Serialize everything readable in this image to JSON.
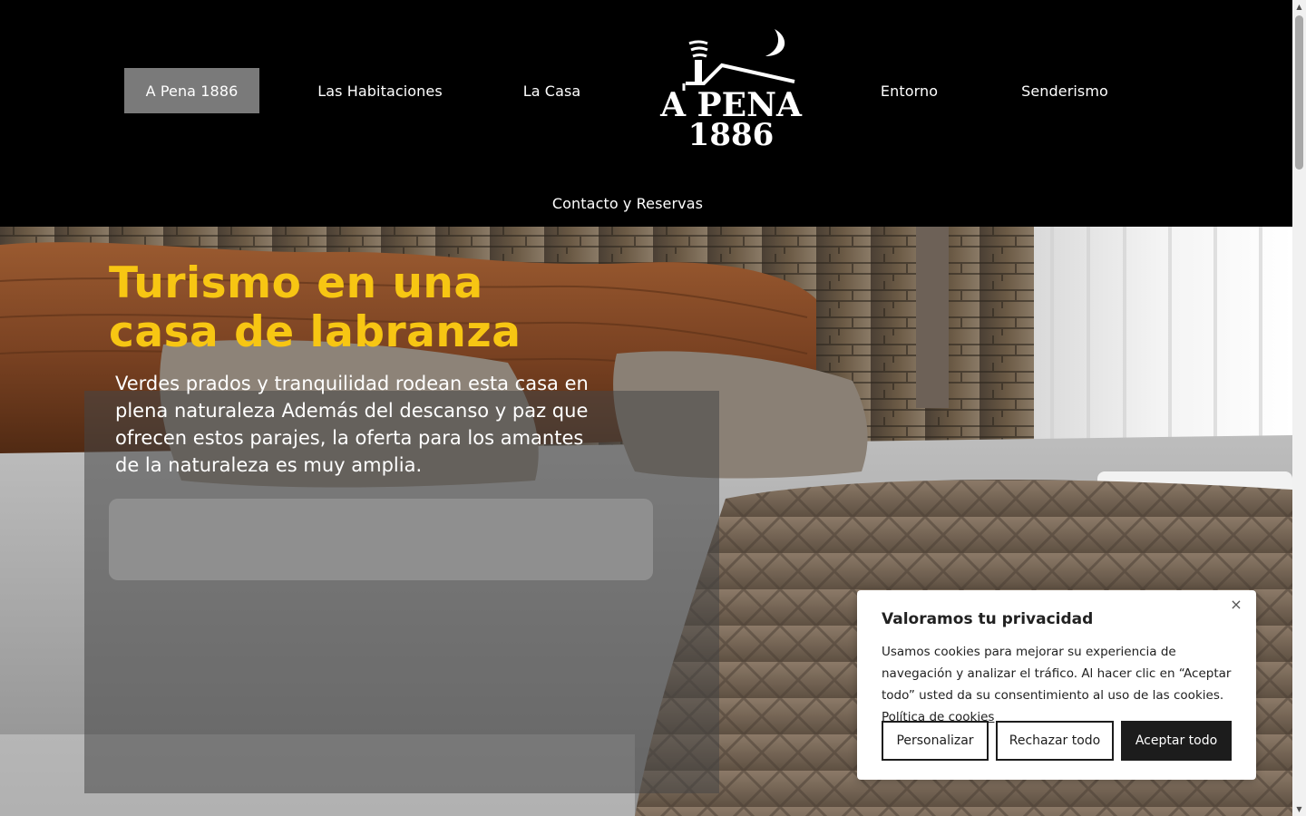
{
  "nav": {
    "items": [
      {
        "label": "A Pena 1886",
        "active": true
      },
      {
        "label": "Las Habitaciones",
        "active": false
      },
      {
        "label": "La Casa",
        "active": false
      },
      {
        "label": "Entorno",
        "active": false
      },
      {
        "label": "Senderismo",
        "active": false
      },
      {
        "label": "Contacto y Reservas",
        "active": false
      }
    ],
    "logo": {
      "line1": "A PENA",
      "line2": "1886"
    }
  },
  "hero": {
    "title_line1": "Turismo en una",
    "title_line2": "casa de labranza",
    "description": "Verdes prados y tranquilidad rodean esta casa en plena naturaleza Además del descanso y paz que ofrecen estos parajes, la oferta para los amantes de la naturaleza es muy amplia."
  },
  "cookie": {
    "title": "Valoramos tu privacidad",
    "text": "Usamos cookies para mejorar su experiencia de navegación y analizar el tráfico. Al hacer clic en “Aceptar todo” usted da su consentimiento al uso de las cookies.",
    "policy_link": "Política de cookies",
    "customize": "Personalizar",
    "reject": "Rechazar todo",
    "accept": "Aceptar todo",
    "close": "×"
  },
  "colors": {
    "header_bg": "#000000",
    "active_nav_bg": "#7a7a7a",
    "title_yellow": "#f7c613"
  }
}
